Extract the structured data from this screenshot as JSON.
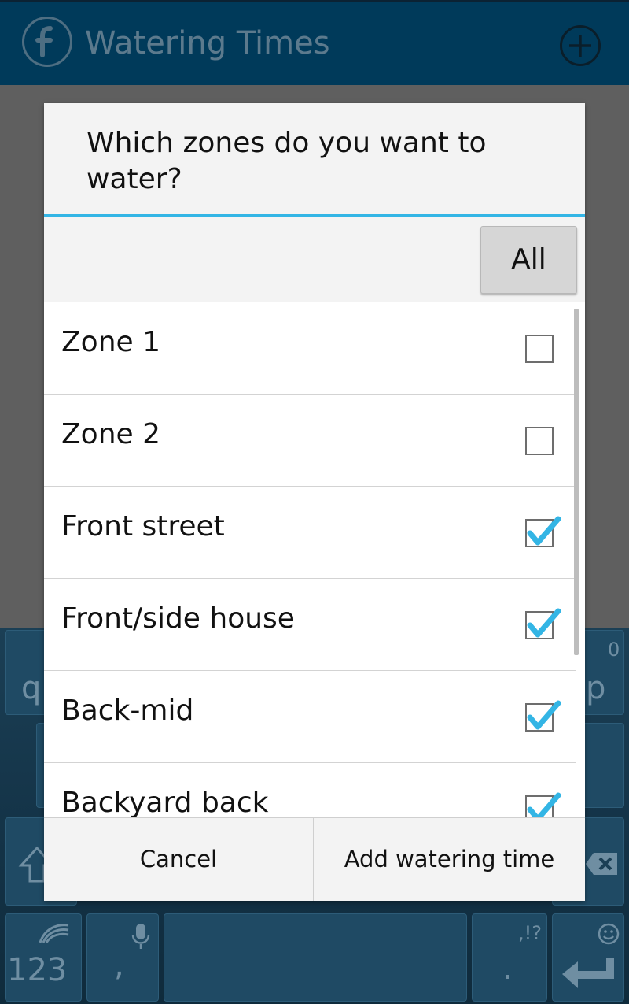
{
  "app": {
    "title": "Watering Times",
    "brand_color": "#003a5a",
    "logo_icon": "f-logo-icon",
    "add_icon": "plus-circle-icon"
  },
  "dialog": {
    "title": "Which zones do you want to water?",
    "accent_color": "#33b5e5",
    "all_button": "All",
    "zones": [
      {
        "label": "Zone 1",
        "checked": false
      },
      {
        "label": "Zone 2",
        "checked": false
      },
      {
        "label": "Front street",
        "checked": true
      },
      {
        "label": "Front/side house",
        "checked": true
      },
      {
        "label": "Back-mid",
        "checked": true
      },
      {
        "label": "Backyard back",
        "checked": true
      }
    ],
    "cancel_label": "Cancel",
    "confirm_label": "Add watering time"
  },
  "keyboard": {
    "key_q": "q",
    "key_p": "p",
    "key_p_alt": "0",
    "key_numbers": "123",
    "key_comma": ",",
    "key_period": ".",
    "key_punct_alt": ",!?",
    "shift_icon": "shift-icon",
    "backspace_icon": "backspace-icon",
    "mic_icon": "mic-icon",
    "smiley_icon": "smiley-icon",
    "enter_icon": "enter-icon",
    "swiftkey_icon": "swiftkey-logo-icon"
  }
}
